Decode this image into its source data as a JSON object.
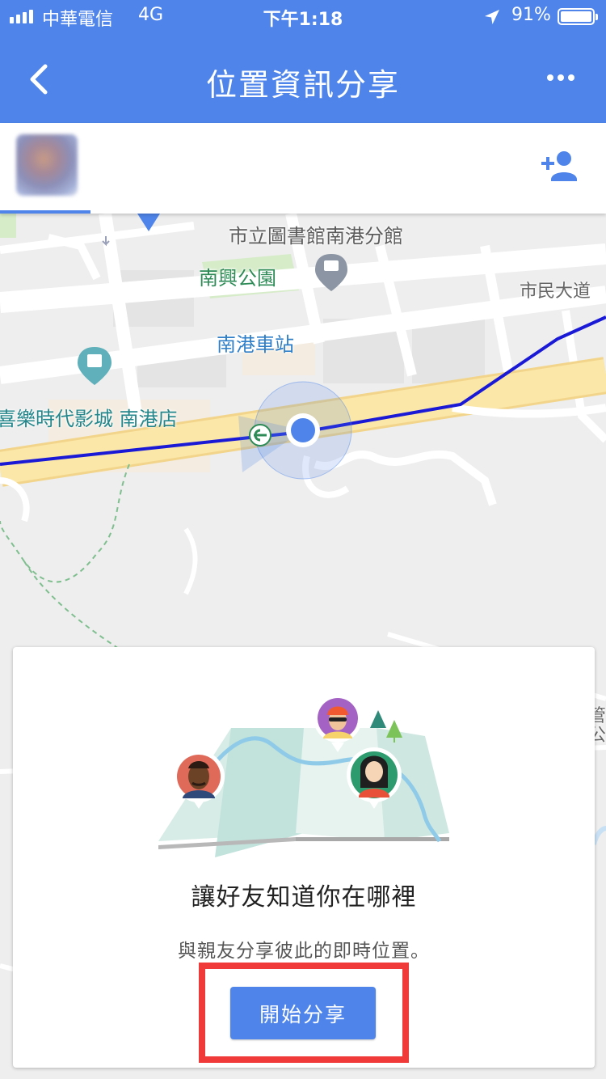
{
  "status_bar": {
    "carrier": "中華電信",
    "network": "4G",
    "time": "下午1:18",
    "battery": "91%",
    "battery_level": 0.91,
    "icons": [
      "signal-bars-icon",
      "location-arrow-icon",
      "battery-icon"
    ]
  },
  "header": {
    "title": "位置資訊分享",
    "back_icon": "chevron-left-icon",
    "more_icon": "more-dots-icon"
  },
  "people_bar": {
    "add_person_icon": "add-person-icon"
  },
  "map": {
    "labels": {
      "library": "市立圖書館南港分館",
      "park": "南興公園",
      "station": "南港車站",
      "cinema": "喜樂時代影城 南港店",
      "road": "市民大道",
      "edge": "管公"
    },
    "colors": {
      "route": "#1a1ad6",
      "location_dot": "#4f85ea",
      "highway": "#fbe7a8"
    }
  },
  "card": {
    "title": "讓好友知道你在哪裡",
    "subtitle": "與親友分享彼此的即時位置。",
    "button_label": "開始分享"
  },
  "colors": {
    "accent": "#4f85ea",
    "highlight_box": "#f03a3a"
  }
}
